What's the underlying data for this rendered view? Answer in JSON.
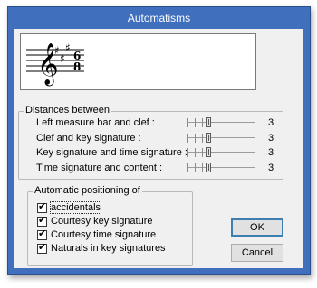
{
  "window": {
    "title": "Automatisms"
  },
  "distances": {
    "label": "Distances between",
    "rows": [
      {
        "label": "Left measure bar and clef :",
        "value": "3"
      },
      {
        "label": "Clef and key signature :",
        "value": "3"
      },
      {
        "label": "Key signature and time signature :",
        "value": "3"
      },
      {
        "label": "Time signature and content :",
        "value": "3"
      }
    ]
  },
  "auto_positioning": {
    "label": "Automatic positioning of",
    "items": [
      {
        "label": "accidentals",
        "checked": true
      },
      {
        "label": "Courtesy key signature",
        "checked": true
      },
      {
        "label": "Courtesy time signature",
        "checked": true
      },
      {
        "label": "Naturals in key signatures",
        "checked": true
      }
    ]
  },
  "buttons": {
    "ok": "OK",
    "cancel": "Cancel"
  },
  "check_glyph": "✔",
  "preview": {
    "clef": "treble-clef-icon",
    "key_signature": "3 sharps",
    "time_signature": {
      "top": "6",
      "bottom": "8"
    }
  }
}
